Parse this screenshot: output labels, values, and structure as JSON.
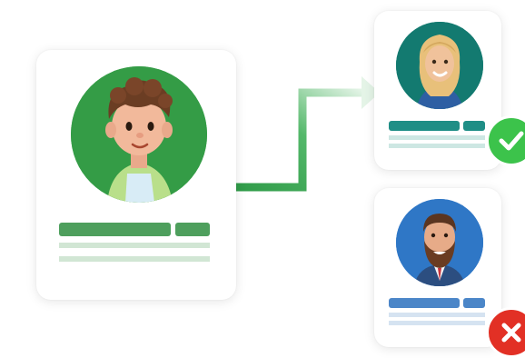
{
  "colors": {
    "primary_green": "#3d9a4f",
    "avatar_bg_main": "#349c46",
    "avatar_bg_accepted": "#137a70",
    "avatar_bg_rejected": "#2f77c6",
    "bar_green": "#4e9f5d",
    "bar_teal": "#1f8e86",
    "bar_blue": "#4b86c8",
    "line_green": "#d1e6d4",
    "line_teal": "#cde7e3",
    "line_blue": "#d5e3f1",
    "check_green": "#3cc34b",
    "cross_red": "#e23025"
  },
  "cards": {
    "main": {
      "avatar_icon": "curly-hair-boy-icon"
    },
    "accepted": {
      "avatar_icon": "blonde-woman-icon",
      "status_icon": "checkmark-icon"
    },
    "rejected": {
      "avatar_icon": "bearded-man-icon",
      "status_icon": "cross-icon"
    }
  },
  "connector": {
    "icon": "arrow-right-icon"
  }
}
